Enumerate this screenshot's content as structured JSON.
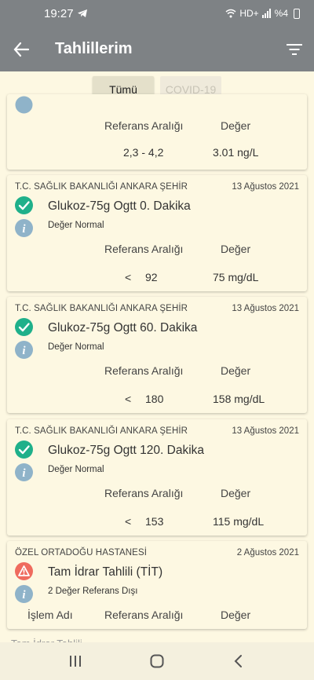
{
  "status_bar": {
    "time": "19:27",
    "network": "HD+",
    "battery": "%4"
  },
  "app_bar": {
    "title": "Tahlillerim"
  },
  "tabs": [
    {
      "label": "Tümü"
    },
    {
      "label": "COVID-19"
    }
  ],
  "top_card": {
    "ref_header": "Referans Aralığı",
    "value_header": "Değer",
    "ref_range": "2,3 - 4,2",
    "value": "3.01 ng/L"
  },
  "cards": [
    {
      "hospital": "T.C. SAĞLIK BAKANLIĞI ANKARA ŞEHİR",
      "date": "13 Ağustos 2021",
      "test": "Glukoz-75g Ogtt 0. Dakika",
      "note": "Değer Normal",
      "ref_header": "Referans Aralığı",
      "value_header": "Değer",
      "operator": "<",
      "ref": "92",
      "value": "75 mg/dL"
    },
    {
      "hospital": "T.C. SAĞLIK BAKANLIĞI ANKARA ŞEHİR",
      "date": "13 Ağustos 2021",
      "test": "Glukoz-75g Ogtt 60. Dakika",
      "note": "Değer Normal",
      "ref_header": "Referans Aralığı",
      "value_header": "Değer",
      "operator": "<",
      "ref": "180",
      "value": "158 mg/dL"
    },
    {
      "hospital": "T.C. SAĞLIK BAKANLIĞI ANKARA ŞEHİR",
      "date": "13 Ağustos 2021",
      "test": "Glukoz-75g Ogtt 120. Dakika",
      "note": "Değer Normal",
      "ref_header": "Referans Aralığı",
      "value_header": "Değer",
      "operator": "<",
      "ref": "153",
      "value": "115 mg/dL"
    }
  ],
  "last_card": {
    "hospital": "ÖZEL ORTADOĞU HASTANESİ",
    "date": "2 Ağustos 2021",
    "test": "Tam İdrar Tahlili (TİT)",
    "note": "2 Değer Referans Dışı",
    "op_header": "İşlem Adı",
    "ref_header": "Referans Aralığı",
    "value_header": "Değer"
  },
  "peek_text": "Tam İdrar Tahlili",
  "colors": {
    "ok": "#1fb08a",
    "warn": "#ef6b5e",
    "info": "#8fb3c9",
    "bar": "#7e8285"
  }
}
